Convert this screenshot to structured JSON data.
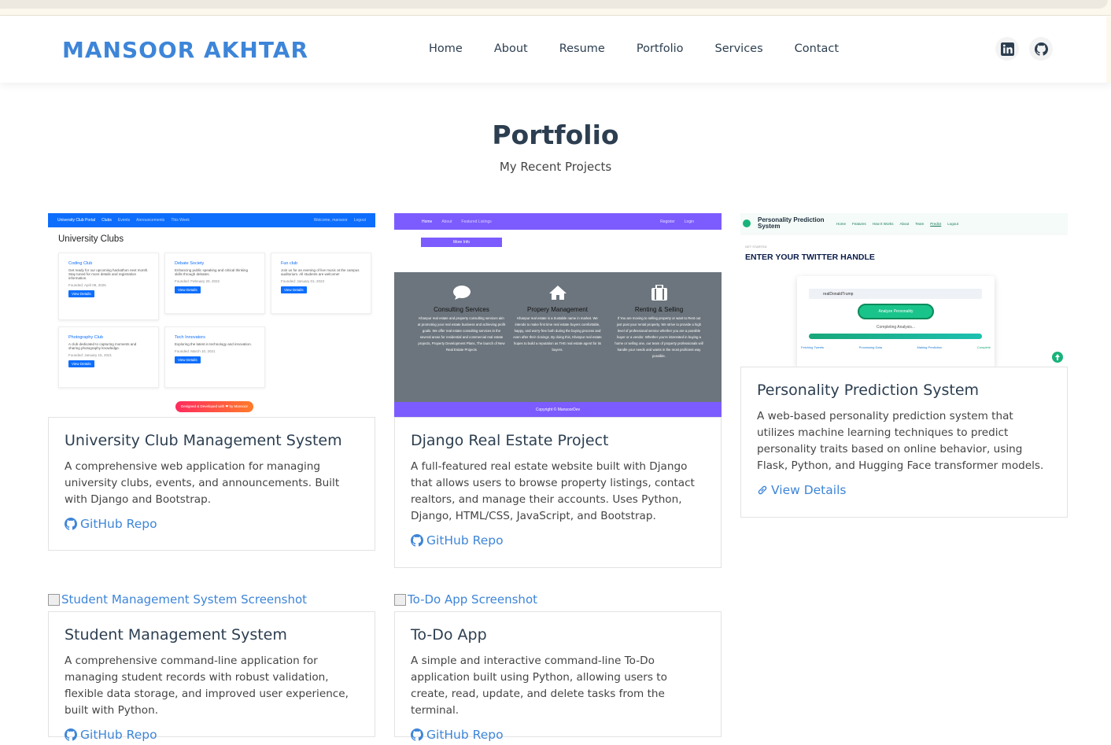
{
  "brand": "MANSOOR AKHTAR",
  "nav": [
    "Home",
    "About",
    "Resume",
    "Portfolio",
    "Services",
    "Contact"
  ],
  "social": [
    "linkedin-icon",
    "github-icon"
  ],
  "section": {
    "title": "Portfolio",
    "subtitle": "My Recent Projects"
  },
  "colors": {
    "accent": "#3d85d8",
    "text": "#2c3e50",
    "purple": "#7c5cff",
    "gray": "#6c757d"
  },
  "projects": [
    {
      "title": "University Club Management System",
      "desc": "A comprehensive web application for managing university clubs, events, and announcements. Built with Django and Bootstrap.",
      "link": "GitHub Repo",
      "link_icon": "github-icon",
      "shot": {
        "nav_brand": "University Club Portal",
        "nav_links": [
          "Clubs",
          "Events",
          "Announcements",
          "This Week"
        ],
        "nav_right": [
          "Welcome, mansoor",
          "Logout"
        ],
        "heading": "University Clubs",
        "clubs": [
          {
            "name": "Coding Club",
            "text": "Get ready for our upcoming hackathon next month. Stay tuned for more details and registration information.",
            "founded": "Founded: April 09, 2025",
            "btn": "View Details"
          },
          {
            "name": "Debate Society",
            "text": "Enhancing public speaking and critical thinking skills through debates.",
            "founded": "Founded: February 20, 2022",
            "btn": "View Details"
          },
          {
            "name": "Fun club",
            "text": "Join us for an evening of live music at the campus auditorium. All students are welcome!",
            "founded": "Founded: January 01, 2023",
            "btn": "View Details"
          },
          {
            "name": "Photography Club",
            "text": "A club dedicated to capturing moments and sharing photography knowledge.",
            "founded": "Founded: January 15, 2021",
            "btn": "View Details"
          },
          {
            "name": "Tech Innovators",
            "text": "Exploring the latest in technology and innovation.",
            "founded": "Founded: March 10, 2021",
            "btn": "View Details"
          }
        ],
        "footer": "Designed & Developed with ❤ by Mansoor"
      }
    },
    {
      "title": "Django Real Estate Project",
      "desc": "A full-featured real estate website built with Django that allows users to browse property listings, contact realtors, and manage their accounts. Uses Python, Django, HTML/CSS, JavaScript, and Bootstrap.",
      "link": "GitHub Repo",
      "link_icon": "github-icon",
      "shot": {
        "nav_links": [
          "Home",
          "About",
          "Featured Listings"
        ],
        "nav_right": [
          "Register",
          "Login"
        ],
        "more_btn": "More Info",
        "services": [
          {
            "icon": "comment-icon",
            "title": "Consulting Services",
            "text": "Khanpur real estate and property consulting services aim at promoting your real estate business and achieving profit goals. We offer real estate consulting services in the several areas for residential and commercial real estate projects, Property Development Plans, The launch of New Real Estate Projects"
          },
          {
            "icon": "home-icon",
            "title": "Propery Management",
            "text": "Khanpur real estate is a trustable name in market. We intends to make first time real estate buyers comfortable, happy, and worry-free both during the buying process and even after their closings. By doing this, Khanpur real estate hopes to build a reputation as THE real estate agent for its buyers."
          },
          {
            "icon": "suitcase-icon",
            "title": "Renting & Selling",
            "text": "If You are moving to selling property or want to Rent out just post your rental property. We strive to provide a high level of professional service whether you are a possible buyer or a vendor. Whether you're interested in buying a home or selling one, our team of property professionals will handle your needs and wants in the most proficient way possible."
          }
        ],
        "copyright": "Copyright © MansoorDev"
      }
    },
    {
      "title": "Personality Prediction System",
      "desc": "A web-based personality prediction system that utilizes machine learning techniques to predict personality traits based on online behavior, using Flask, Python, and Hugging Face transformer models.",
      "link": "View Details",
      "link_icon": "link-icon",
      "shot": {
        "brand": "Personality Prediction System",
        "nav_links": [
          "Home",
          "Features",
          "How It Works",
          "About",
          "Team",
          "Predict",
          "Logout"
        ],
        "eyebrow": "GET STARTED",
        "heading": "ENTER YOUR TWITTER HANDLE",
        "input_value": "realDonaldTrump",
        "button": "Analyze Personality",
        "progress_label": "Completing Analysis...",
        "progress": 1.0,
        "steps": [
          "Fetching Tweets",
          "Processing Data",
          "Making Prediction",
          "Complete"
        ]
      }
    },
    {
      "title": "Student Management System",
      "desc": "A comprehensive command-line application for managing student records with robust validation, flexible data storage, and improved user experience, built with Python.",
      "link": "GitHub Repo",
      "link_icon": "github-icon",
      "img_alt": "Student Management System Screenshot"
    },
    {
      "title": "To-Do App",
      "desc": "A simple and interactive command-line To-Do application built using Python, allowing users to create, read, update, and delete tasks from the terminal.",
      "link": "GitHub Repo",
      "link_icon": "github-icon",
      "img_alt": "To-Do App Screenshot"
    }
  ]
}
